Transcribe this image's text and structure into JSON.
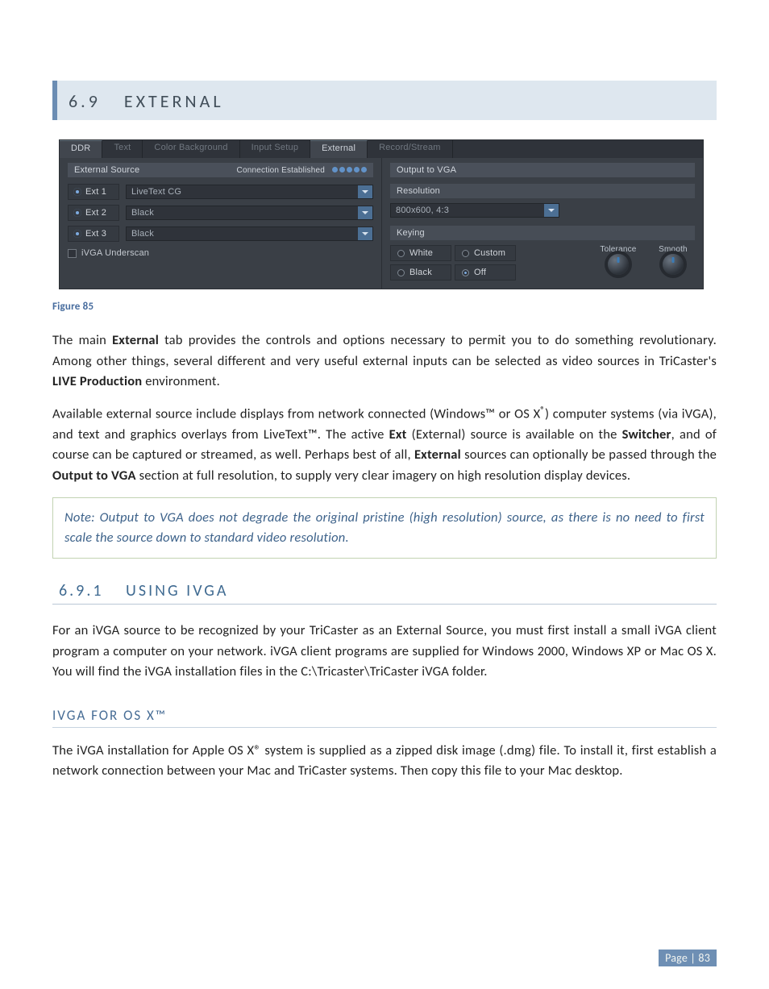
{
  "heading69": {
    "num": "6.9",
    "title": "EXTERNAL"
  },
  "tabs": [
    "DDR",
    "Text",
    "Color Background",
    "Input Setup",
    "External",
    "Record/Stream"
  ],
  "active_tab_primary": "DDR",
  "active_tab_secondary": "External",
  "left_pane": {
    "title": "External Source",
    "status": "Connection Established",
    "rows": [
      {
        "label": "Ext 1",
        "value": "LiveText CG"
      },
      {
        "label": "Ext 2",
        "value": "Black"
      },
      {
        "label": "Ext 3",
        "value": "Black"
      }
    ],
    "checkbox": "iVGA Underscan"
  },
  "right_pane": {
    "title": "Output to VGA",
    "res_label": "Resolution",
    "res_value": "800x600, 4:3",
    "key_label": "Keying",
    "radios": {
      "a": "White",
      "b": "Custom",
      "c": "Black",
      "d": "Off"
    },
    "knob1": "Tolerance",
    "knob2": "Smooth"
  },
  "figure_caption": "Figure 85",
  "para1_a": "The main ",
  "para1_b": "External",
  "para1_c": " tab provides the controls and options necessary to permit you to do something revolutionary.  Among other things, several different and very useful external inputs can be selected as video sources in TriCaster's ",
  "para1_d": "LIVE Production",
  "para1_e": " environment.",
  "para2_a": "Available external source include displays from network connected (Windows™ or OS X",
  "para2_reg": "®",
  "para2_b": ") computer systems (via iVGA), and text and graphics overlays from LiveText™.  The active ",
  "para2_c": "Ext",
  "para2_d": " (External) source is available on the ",
  "para2_e": "Switcher",
  "para2_f": ", and of course can be captured or streamed, as well.  Perhaps best of all, ",
  "para2_g": "External",
  "para2_h": " sources can optionally be passed through the ",
  "para2_i": "Output to VGA",
  "para2_j": " section at full resolution, to supply very clear imagery on high resolution display devices.",
  "note": "Note: Output to VGA does not degrade the original pristine (high resolution) source, as there is no need to first scale the source down to standard video resolution.",
  "heading691": {
    "num": "6.9.1",
    "title": "USING IVGA"
  },
  "para3": "For an iVGA source to be recognized by your TriCaster as an External Source, you must first install a small iVGA client program a computer on your network.  iVGA client programs are supplied for Windows 2000, Windows XP or Mac OS X.   You will find the iVGA installation files in the C:\\Tricaster\\TriCaster iVGA folder.",
  "osx_heading": "IVGA FOR OS X™",
  "para4": "The iVGA installation for Apple OS X® system is supplied as a zipped disk image (.dmg) file.  To install it, first establish a network connection between your Mac and TriCaster systems. Then copy this file to your Mac desktop.",
  "page_number": "Page | 83"
}
